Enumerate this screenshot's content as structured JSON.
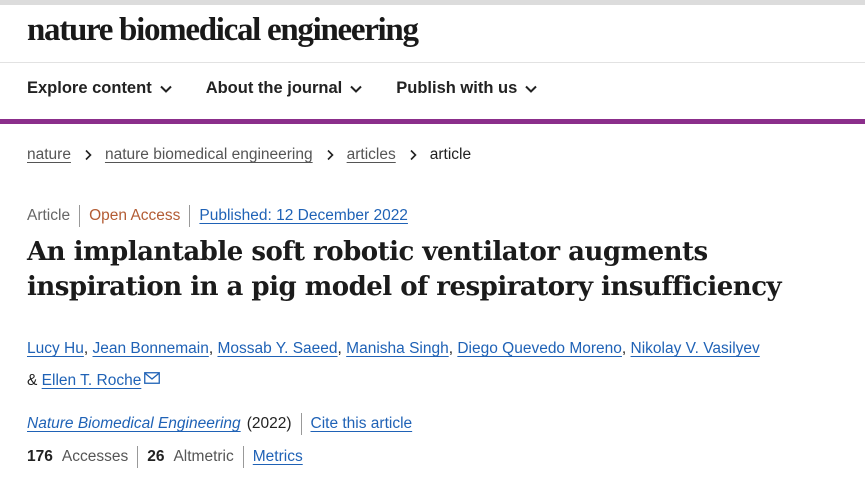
{
  "header": {
    "logo_text": "nature biomedical engineering"
  },
  "nav": {
    "items": [
      {
        "label": "Explore content",
        "icon": "chevron-down-icon"
      },
      {
        "label": "About the journal",
        "icon": "chevron-down-icon"
      },
      {
        "label": "Publish with us",
        "icon": "chevron-down-icon"
      }
    ]
  },
  "breadcrumb": {
    "items": [
      "nature",
      "nature biomedical engineering",
      "articles"
    ],
    "current": "article"
  },
  "article": {
    "type": "Article",
    "access": "Open Access",
    "published": "Published: 12 December 2022",
    "title": "An implantable soft robotic ventilator augments inspiration in a pig model of respiratory insufficiency",
    "authors": [
      "Lucy Hu",
      "Jean Bonnemain",
      "Mossab Y. Saeed",
      "Manisha Singh",
      "Diego Quevedo Moreno",
      "Nikolay V. Vasilyev",
      "Ellen T. Roche"
    ],
    "ampersand": "&",
    "journal": "Nature Biomedical Engineering",
    "year": "(2022)",
    "cite_label": "Cite this article",
    "accesses_count": "176",
    "accesses_label": "Accesses",
    "altmetric_count": "26",
    "altmetric_label": "Altmetric",
    "metrics_label": "Metrics"
  },
  "colors": {
    "accent_purple": "#8b2e8b",
    "link_blue": "#1f62b6",
    "open_access_orange": "#b35c34"
  }
}
